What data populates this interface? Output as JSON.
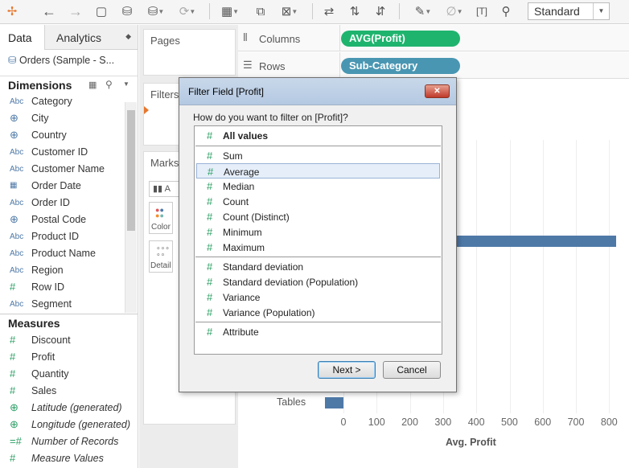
{
  "toolbar": {
    "icons": [
      "tableau-logo-icon",
      "back-icon",
      "forward-icon",
      "save-icon",
      "new-datasource-icon",
      "pause-updates-icon",
      "refresh-icon",
      "new-worksheet-icon",
      "duplicate-icon",
      "clear-sheet-icon",
      "swap-icon",
      "sort-ascending-icon",
      "sort-descending-icon",
      "highlight-icon",
      "paperclip-icon",
      "label-icon",
      "pin-icon"
    ],
    "fit_value": "Standard"
  },
  "left_pane": {
    "tabs": {
      "data": "Data",
      "analytics": "Analytics"
    },
    "datasource": "Orders (Sample - S...",
    "dimensions_title": "Dimensions",
    "dimensions": [
      {
        "type": "Abc",
        "label": "Category"
      },
      {
        "type": "globe",
        "label": "City"
      },
      {
        "type": "globe",
        "label": "Country"
      },
      {
        "type": "Abc",
        "label": "Customer ID"
      },
      {
        "type": "Abc",
        "label": "Customer Name"
      },
      {
        "type": "date",
        "label": "Order Date"
      },
      {
        "type": "Abc",
        "label": "Order ID"
      },
      {
        "type": "globe",
        "label": "Postal Code"
      },
      {
        "type": "Abc",
        "label": "Product ID"
      },
      {
        "type": "Abc",
        "label": "Product Name"
      },
      {
        "type": "Abc",
        "label": "Region"
      },
      {
        "type": "#",
        "label": "Row ID"
      },
      {
        "type": "Abc",
        "label": "Segment"
      }
    ],
    "measures_title": "Measures",
    "measures": [
      {
        "type": "#",
        "label": "Discount"
      },
      {
        "type": "#",
        "label": "Profit"
      },
      {
        "type": "#",
        "label": "Quantity"
      },
      {
        "type": "#",
        "label": "Sales"
      },
      {
        "type": "globe",
        "label": "Latitude (generated)"
      },
      {
        "type": "globe",
        "label": "Longitude (generated)"
      },
      {
        "type": "=#",
        "label": "Number of Records"
      },
      {
        "type": "#",
        "label": "Measure Values"
      }
    ]
  },
  "cards": {
    "pages": "Pages",
    "filters": "Filters",
    "marks": "Marks",
    "marks_type": "A",
    "color": "Color",
    "detail": "Detail"
  },
  "shelves": {
    "columns_label": "Columns",
    "columns_pill": "AVG(Profit)",
    "rows_label": "Rows",
    "rows_pill": "Sub-Category"
  },
  "viz": {
    "row_label": "Tables",
    "x_ticks": [
      "0",
      "100",
      "200",
      "300",
      "400",
      "500",
      "600",
      "700",
      "800"
    ],
    "x_title": "Avg. Profit",
    "colors": {
      "bar": "#4e79a7",
      "columns_pill": "#1fb46e",
      "rows_pill": "#4996b2"
    }
  },
  "chart_data": {
    "type": "bar",
    "orientation": "horizontal",
    "categories": [
      "Tables"
    ],
    "values": [
      -56
    ],
    "visible_partial_bar_value_approx": 820,
    "xlabel": "Avg. Profit",
    "xlim": [
      -60,
      830
    ]
  },
  "dialog": {
    "title": "Filter Field [Profit]",
    "close": "✕",
    "question": "How do you want to filter on [Profit]?",
    "groups": [
      [
        {
          "label": "All values",
          "bold": true
        }
      ],
      [
        {
          "label": "Sum"
        },
        {
          "label": "Average",
          "selected": true
        },
        {
          "label": "Median"
        },
        {
          "label": "Count"
        },
        {
          "label": "Count (Distinct)"
        },
        {
          "label": "Minimum"
        },
        {
          "label": "Maximum"
        }
      ],
      [
        {
          "label": "Standard deviation"
        },
        {
          "label": "Standard deviation (Population)"
        },
        {
          "label": "Variance"
        },
        {
          "label": "Variance (Population)"
        }
      ],
      [
        {
          "label": "Attribute"
        }
      ]
    ],
    "next": "Next >",
    "cancel": "Cancel"
  }
}
